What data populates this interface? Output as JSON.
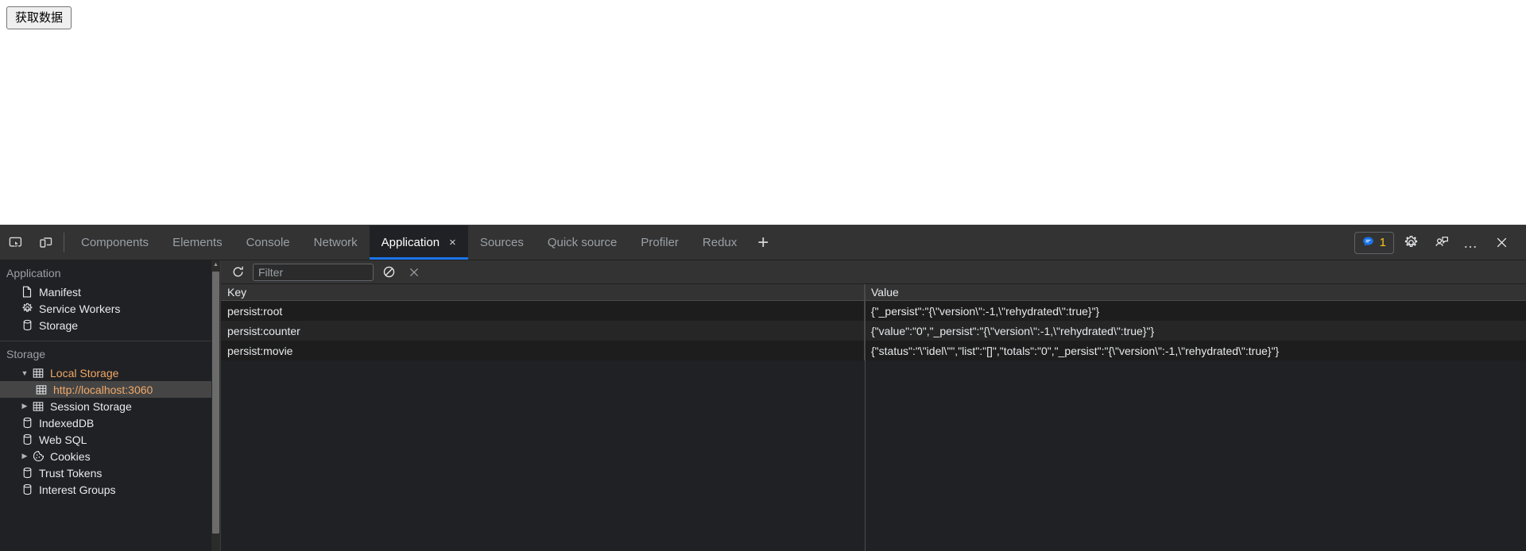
{
  "page": {
    "fetch_button_label": "获取数据"
  },
  "devtools": {
    "left_icons": [
      {
        "name": "inspect-element-icon",
        "title": "Inspect element"
      },
      {
        "name": "device-toolbar-icon",
        "title": "Toggle device toolbar"
      }
    ],
    "tabs": [
      {
        "label": "Components",
        "active": false,
        "closable": false
      },
      {
        "label": "Elements",
        "active": false,
        "closable": false
      },
      {
        "label": "Console",
        "active": false,
        "closable": false
      },
      {
        "label": "Network",
        "active": false,
        "closable": false
      },
      {
        "label": "Application",
        "active": true,
        "closable": true
      },
      {
        "label": "Sources",
        "active": false,
        "closable": false
      },
      {
        "label": "Quick source",
        "active": false,
        "closable": false
      },
      {
        "label": "Profiler",
        "active": false,
        "closable": false
      },
      {
        "label": "Redux",
        "active": false,
        "closable": false
      }
    ],
    "add_tab_label": "+",
    "tab_close_label": "×",
    "issues": {
      "count": "1",
      "icon": "issues-chat-icon"
    },
    "right_icons": [
      {
        "name": "settings-gear-icon"
      },
      {
        "name": "customize-feedback-icon"
      },
      {
        "name": "more-options-icon",
        "label": "…"
      },
      {
        "name": "close-devtools-icon",
        "label": "✕"
      }
    ],
    "accent_color": "#1a73e8",
    "badge_count_color": "#f5c518",
    "highlight_text_color": "#f0a868"
  },
  "sidebar": {
    "sections": [
      {
        "title": "Application",
        "items": [
          {
            "label": "Manifest",
            "icon": "document-icon",
            "indent": 1,
            "arrow": "",
            "selected": false,
            "highlight": false
          },
          {
            "label": "Service Workers",
            "icon": "gear-icon",
            "indent": 1,
            "arrow": "",
            "selected": false,
            "highlight": false
          },
          {
            "label": "Storage",
            "icon": "database-icon",
            "indent": 1,
            "arrow": "",
            "selected": false,
            "highlight": false
          }
        ]
      },
      {
        "title": "Storage",
        "items": [
          {
            "label": "Local Storage",
            "icon": "table-icon",
            "indent": 1,
            "arrow": "▼",
            "selected": false,
            "highlight": true
          },
          {
            "label": "http://localhost:3060",
            "icon": "table-icon",
            "indent": 2,
            "arrow": "",
            "selected": true,
            "highlight": true
          },
          {
            "label": "Session Storage",
            "icon": "table-icon",
            "indent": 1,
            "arrow": "▶",
            "selected": false,
            "highlight": false
          },
          {
            "label": "IndexedDB",
            "icon": "database-icon",
            "indent": 1,
            "arrow": "",
            "selected": false,
            "highlight": false
          },
          {
            "label": "Web SQL",
            "icon": "database-icon",
            "indent": 1,
            "arrow": "",
            "selected": false,
            "highlight": false
          },
          {
            "label": "Cookies",
            "icon": "cookie-icon",
            "indent": 1,
            "arrow": "▶",
            "selected": false,
            "highlight": false
          },
          {
            "label": "Trust Tokens",
            "icon": "database-icon",
            "indent": 1,
            "arrow": "",
            "selected": false,
            "highlight": false
          },
          {
            "label": "Interest Groups",
            "icon": "database-icon",
            "indent": 1,
            "arrow": "",
            "selected": false,
            "highlight": false
          }
        ]
      }
    ]
  },
  "panel": {
    "toolbar": {
      "refresh_icon": "refresh-icon",
      "filter_placeholder": "Filter",
      "filter_value": "",
      "clear_icon": "clear-filter-icon",
      "delete_icon": "delete-selected-icon"
    },
    "table": {
      "columns": [
        "Key",
        "Value"
      ],
      "rows": [
        {
          "key": "persist:root",
          "value": "{\"_persist\":\"{\\\"version\\\":-1,\\\"rehydrated\\\":true}\"}"
        },
        {
          "key": "persist:counter",
          "value": "{\"value\":\"0\",\"_persist\":\"{\\\"version\\\":-1,\\\"rehydrated\\\":true}\"}"
        },
        {
          "key": "persist:movie",
          "value": "{\"status\":\"\\\"idel\\\"\",\"list\":\"[]\",\"totals\":\"0\",\"_persist\":\"{\\\"version\\\":-1,\\\"rehydrated\\\":true}\"}"
        }
      ]
    }
  }
}
